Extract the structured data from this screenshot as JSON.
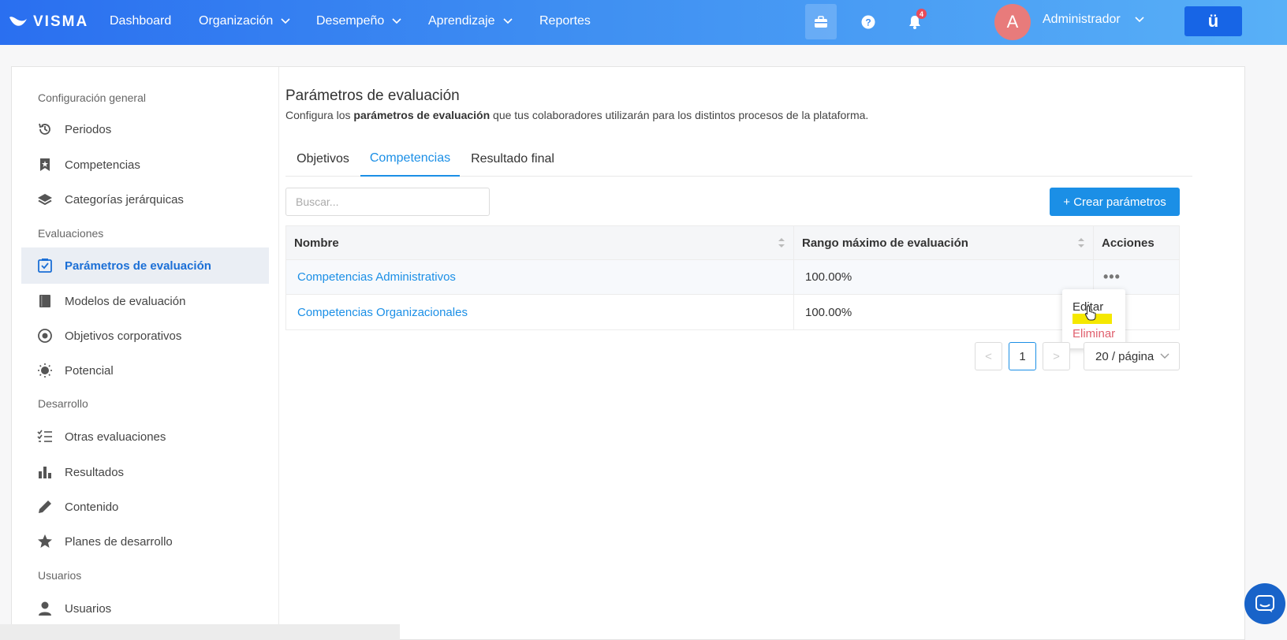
{
  "topbar": {
    "brand": "VISMA",
    "nav": [
      {
        "label": "Dashboard"
      },
      {
        "label": "Organización"
      },
      {
        "label": "Desempeño"
      },
      {
        "label": "Aprendizaje"
      },
      {
        "label": "Reportes"
      }
    ],
    "notification_count": "4",
    "avatar_initial": "A",
    "user_name": "Administrador",
    "brand_button": "ü"
  },
  "sidebar": {
    "sections": [
      {
        "title": "Configuración general"
      },
      {
        "title": "Evaluaciones"
      },
      {
        "title": "Desarrollo"
      },
      {
        "title": "Usuarios"
      }
    ],
    "items": [
      {
        "label": "Periodos",
        "icon": "history-icon"
      },
      {
        "label": "Competencias",
        "icon": "bookmark-icon"
      },
      {
        "label": "Categorías jerárquicas",
        "icon": "layers-icon"
      },
      {
        "label": "Parámetros de evaluación",
        "icon": "checklist-icon",
        "active": true
      },
      {
        "label": "Modelos de evaluación",
        "icon": "book-icon"
      },
      {
        "label": "Objetivos corporativos",
        "icon": "target-icon"
      },
      {
        "label": "Potencial",
        "icon": "lightbulb-icon"
      },
      {
        "label": "Otras evaluaciones",
        "icon": "list-check-icon"
      },
      {
        "label": "Resultados",
        "icon": "bar-chart-icon"
      },
      {
        "label": "Contenido",
        "icon": "pencil-icon"
      },
      {
        "label": "Planes de desarrollo",
        "icon": "star-icon"
      },
      {
        "label": "Usuarios",
        "icon": "user-icon"
      }
    ]
  },
  "main": {
    "title": "Parámetros de evaluación",
    "description_pre": "Configura los ",
    "description_bold": "parámetros de evaluación",
    "description_post": " que tus colaboradores utilizarán para los distintos procesos de la plataforma.",
    "tabs": [
      {
        "label": "Objetivos"
      },
      {
        "label": "Competencias",
        "active": true
      },
      {
        "label": "Resultado final"
      }
    ],
    "search_placeholder": "Buscar...",
    "create_button": "+ Crear parámetros",
    "table": {
      "headers": [
        "Nombre",
        "Rango máximo de evaluación",
        "Acciones"
      ],
      "rows": [
        {
          "name": "Competencias Administrativos",
          "range": "100.00%",
          "actions": "•••"
        },
        {
          "name": "Competencias Organizacionales",
          "range": "100.00%",
          "actions": ""
        }
      ]
    },
    "dropdown": {
      "edit": "Editar",
      "delete": "Eliminar"
    },
    "pagination": {
      "prev": "<",
      "current": "1",
      "next": ">",
      "page_size": "20 / página"
    }
  },
  "colors": {
    "primary": "#1b8fe6",
    "danger": "#e0606e",
    "highlight": "#f5e800",
    "avatar": "#e87b7b"
  }
}
